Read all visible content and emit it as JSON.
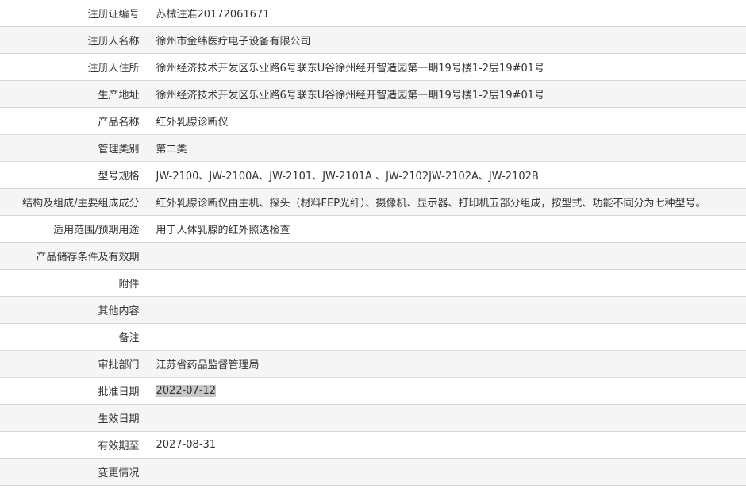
{
  "rows": [
    {
      "label": "注册证编号",
      "value": "苏械注准20172061671"
    },
    {
      "label": "注册人名称",
      "value": "徐州市金纬医疗电子设备有限公司"
    },
    {
      "label": "注册人住所",
      "value": "徐州经济技术开发区乐业路6号联东U谷徐州经开智造园第一期19号楼1-2层19#01号"
    },
    {
      "label": "生产地址",
      "value": "徐州经济技术开发区乐业路6号联东U谷徐州经开智造园第一期19号楼1-2层19#01号"
    },
    {
      "label": "产品名称",
      "value": "红外乳腺诊断仪"
    },
    {
      "label": "管理类别",
      "value": "第二类"
    },
    {
      "label": "型号规格",
      "value": "JW-2100、JW-2100A、JW-2101、JW-2101A 、JW-2102JW-2102A、JW-2102B"
    },
    {
      "label": "结构及组成/主要组成成分",
      "value": "红外乳腺诊断仪由主机、探头（材料FEP光纤）、摄像机、显示器、打印机五部分组成，按型式、功能不同分为七种型号。"
    },
    {
      "label": "适用范围/预期用途",
      "value": "用于人体乳腺的红外照透检查"
    },
    {
      "label": "产品储存条件及有效期",
      "value": ""
    },
    {
      "label": "附件",
      "value": ""
    },
    {
      "label": "其他内容",
      "value": ""
    },
    {
      "label": "备注",
      "value": ""
    },
    {
      "label": "审批部门",
      "value": "江苏省药品监督管理局"
    },
    {
      "label": "批准日期",
      "value": "2022-07-12"
    },
    {
      "label": "生效日期",
      "value": ""
    },
    {
      "label": "有效期至",
      "value": "2027-08-31"
    },
    {
      "label": "变更情况",
      "value": ""
    }
  ]
}
